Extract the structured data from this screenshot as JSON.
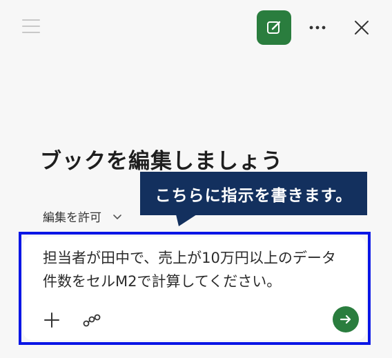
{
  "header": {
    "menu_icon": "hamburger-icon",
    "new_chat_icon": "edit-icon",
    "more_icon": "more-horizontal-icon",
    "close_icon": "close-icon"
  },
  "main": {
    "heading": "ブックを編集しましょう",
    "permission_label": "編集を許可",
    "permission_icon": "chevron-down-icon"
  },
  "callout": {
    "text": "こちらに指示を書きます。"
  },
  "composer": {
    "prompt_line1": "担当者が田中で、売上が10万円以上のデータ",
    "prompt_line2": "件数をセルM2で計算してください。",
    "add_icon": "plus-icon",
    "attach_icon": "link-icon",
    "send_icon": "arrow-right-icon"
  },
  "colors": {
    "accent": "#2a7d3e",
    "callout_bg": "#13305e",
    "highlight_border": "#0a16e6"
  }
}
